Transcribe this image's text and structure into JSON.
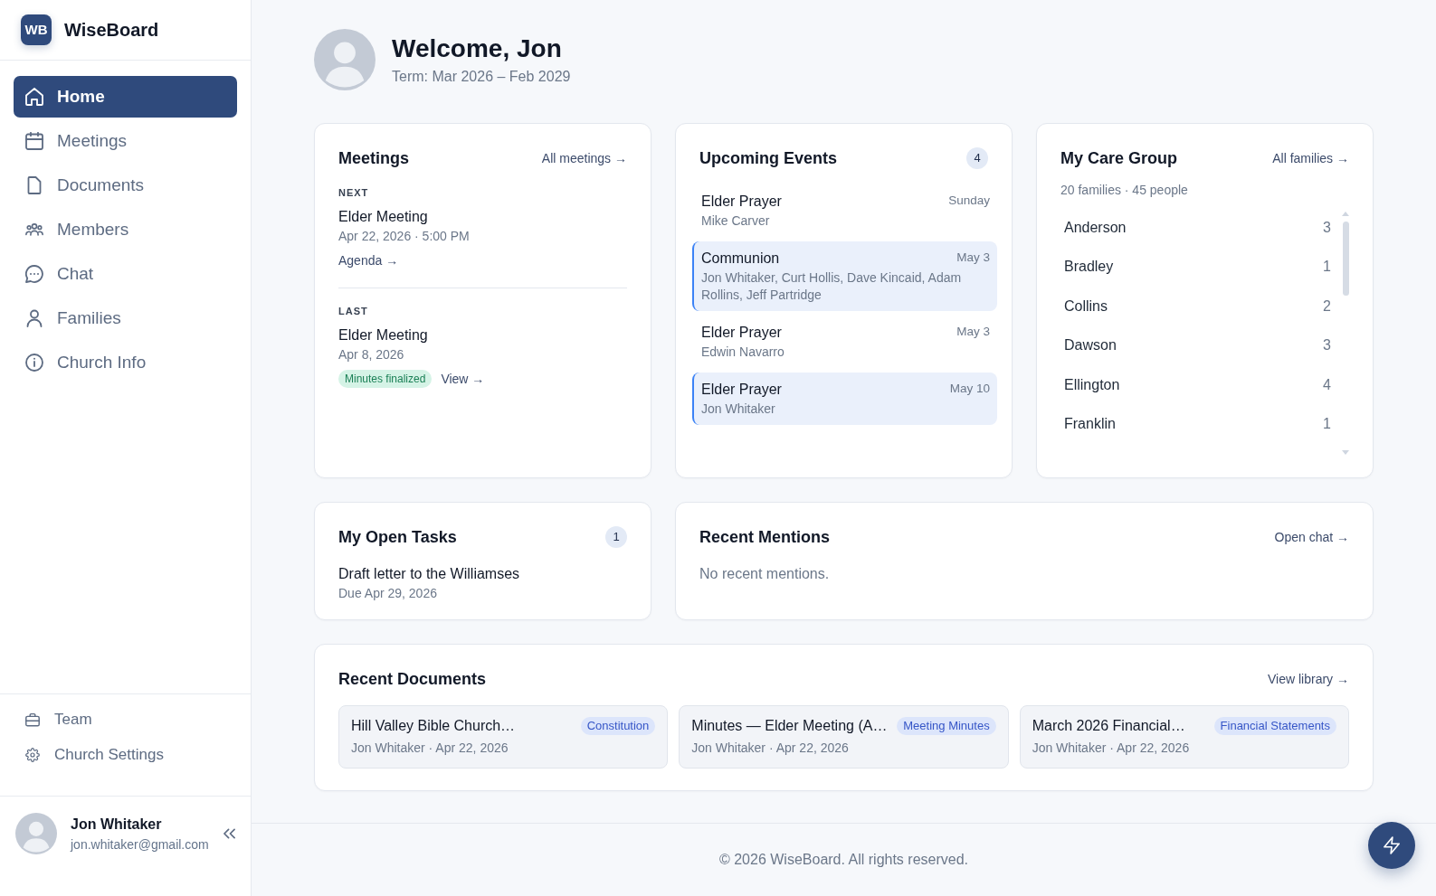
{
  "sidebar": {
    "logo_mark": "WB",
    "app_name": "WiseBoard",
    "nav_items": [
      {
        "label": "Home",
        "selected": true
      },
      {
        "label": "Meetings",
        "selected": false
      },
      {
        "label": "Documents",
        "selected": false
      },
      {
        "label": "Members",
        "selected": false
      },
      {
        "label": "Chat",
        "selected": false
      },
      {
        "label": "Families",
        "selected": false
      },
      {
        "label": "Church Info",
        "selected": false
      }
    ],
    "secondary_items": [
      {
        "label": "Team"
      },
      {
        "label": "Church Settings"
      }
    ],
    "user": {
      "name": "Jon Whitaker",
      "email": "jon.whitaker@gmail.com"
    }
  },
  "header": {
    "title": "Welcome, Jon",
    "subtitle": "Term: Mar 2026 – Feb 2029"
  },
  "meetings": {
    "title": "Meetings",
    "link": "All meetings →",
    "sections": [
      {
        "label": "NEXT",
        "title": "Elder Meeting",
        "detail": "Apr 22, 2026 · 5:00 PM",
        "actions": [
          {
            "kind": "link",
            "text": "Agenda →"
          }
        ]
      },
      {
        "label": "LAST",
        "title": "Elder Meeting",
        "detail": "Apr 8, 2026",
        "actions": [
          {
            "kind": "status",
            "text": "Minutes finalized"
          },
          {
            "kind": "link",
            "text": "View →"
          }
        ]
      }
    ]
  },
  "upcoming_events": {
    "title": "Upcoming Events",
    "count": "4",
    "events": [
      {
        "title": "Elder Prayer",
        "people": "Mike Carver",
        "date": "Sunday",
        "highlighted": false
      },
      {
        "title": "Communion",
        "people": "Jon Whitaker, Curt Hollis, Dave Kincaid, Adam Rollins, Jeff Partridge",
        "date": "May 3",
        "highlighted": true
      },
      {
        "title": "Elder Prayer",
        "people": "Edwin Navarro",
        "date": "May 3",
        "highlighted": false
      },
      {
        "title": "Elder Prayer",
        "people": "Jon Whitaker",
        "date": "May 10",
        "highlighted": true
      }
    ]
  },
  "care_group": {
    "title": "My Care Group",
    "link": "All families →",
    "summary": "20 families · 45 people",
    "families": [
      {
        "name": "Anderson",
        "count": "3"
      },
      {
        "name": "Bradley",
        "count": "1"
      },
      {
        "name": "Collins",
        "count": "2"
      },
      {
        "name": "Dawson",
        "count": "3"
      },
      {
        "name": "Ellington",
        "count": "4"
      },
      {
        "name": "Franklin",
        "count": "1"
      }
    ]
  },
  "open_tasks": {
    "title": "My Open Tasks",
    "count": "1",
    "tasks": [
      {
        "title": "Draft letter to the Williamses",
        "due": "Due Apr 29, 2026"
      }
    ]
  },
  "recent_mentions": {
    "title": "Recent Mentions",
    "link": "Open chat →",
    "empty_text": "No recent mentions."
  },
  "recent_documents": {
    "title": "Recent Documents",
    "link": "View library →",
    "documents": [
      {
        "title": "Hill Valley Bible Church…",
        "tag": "Constitution",
        "meta": "Jon Whitaker · Apr 22, 2026"
      },
      {
        "title": "Minutes — Elder Meeting (A…",
        "tag": "Meeting Minutes",
        "meta": "Jon Whitaker · Apr 22, 2026"
      },
      {
        "title": "March 2026 Financial…",
        "tag": "Financial Statements",
        "meta": "Jon Whitaker · Apr 22, 2026"
      }
    ]
  },
  "footer": {
    "text": "© 2026 WiseBoard. All rights reserved."
  }
}
